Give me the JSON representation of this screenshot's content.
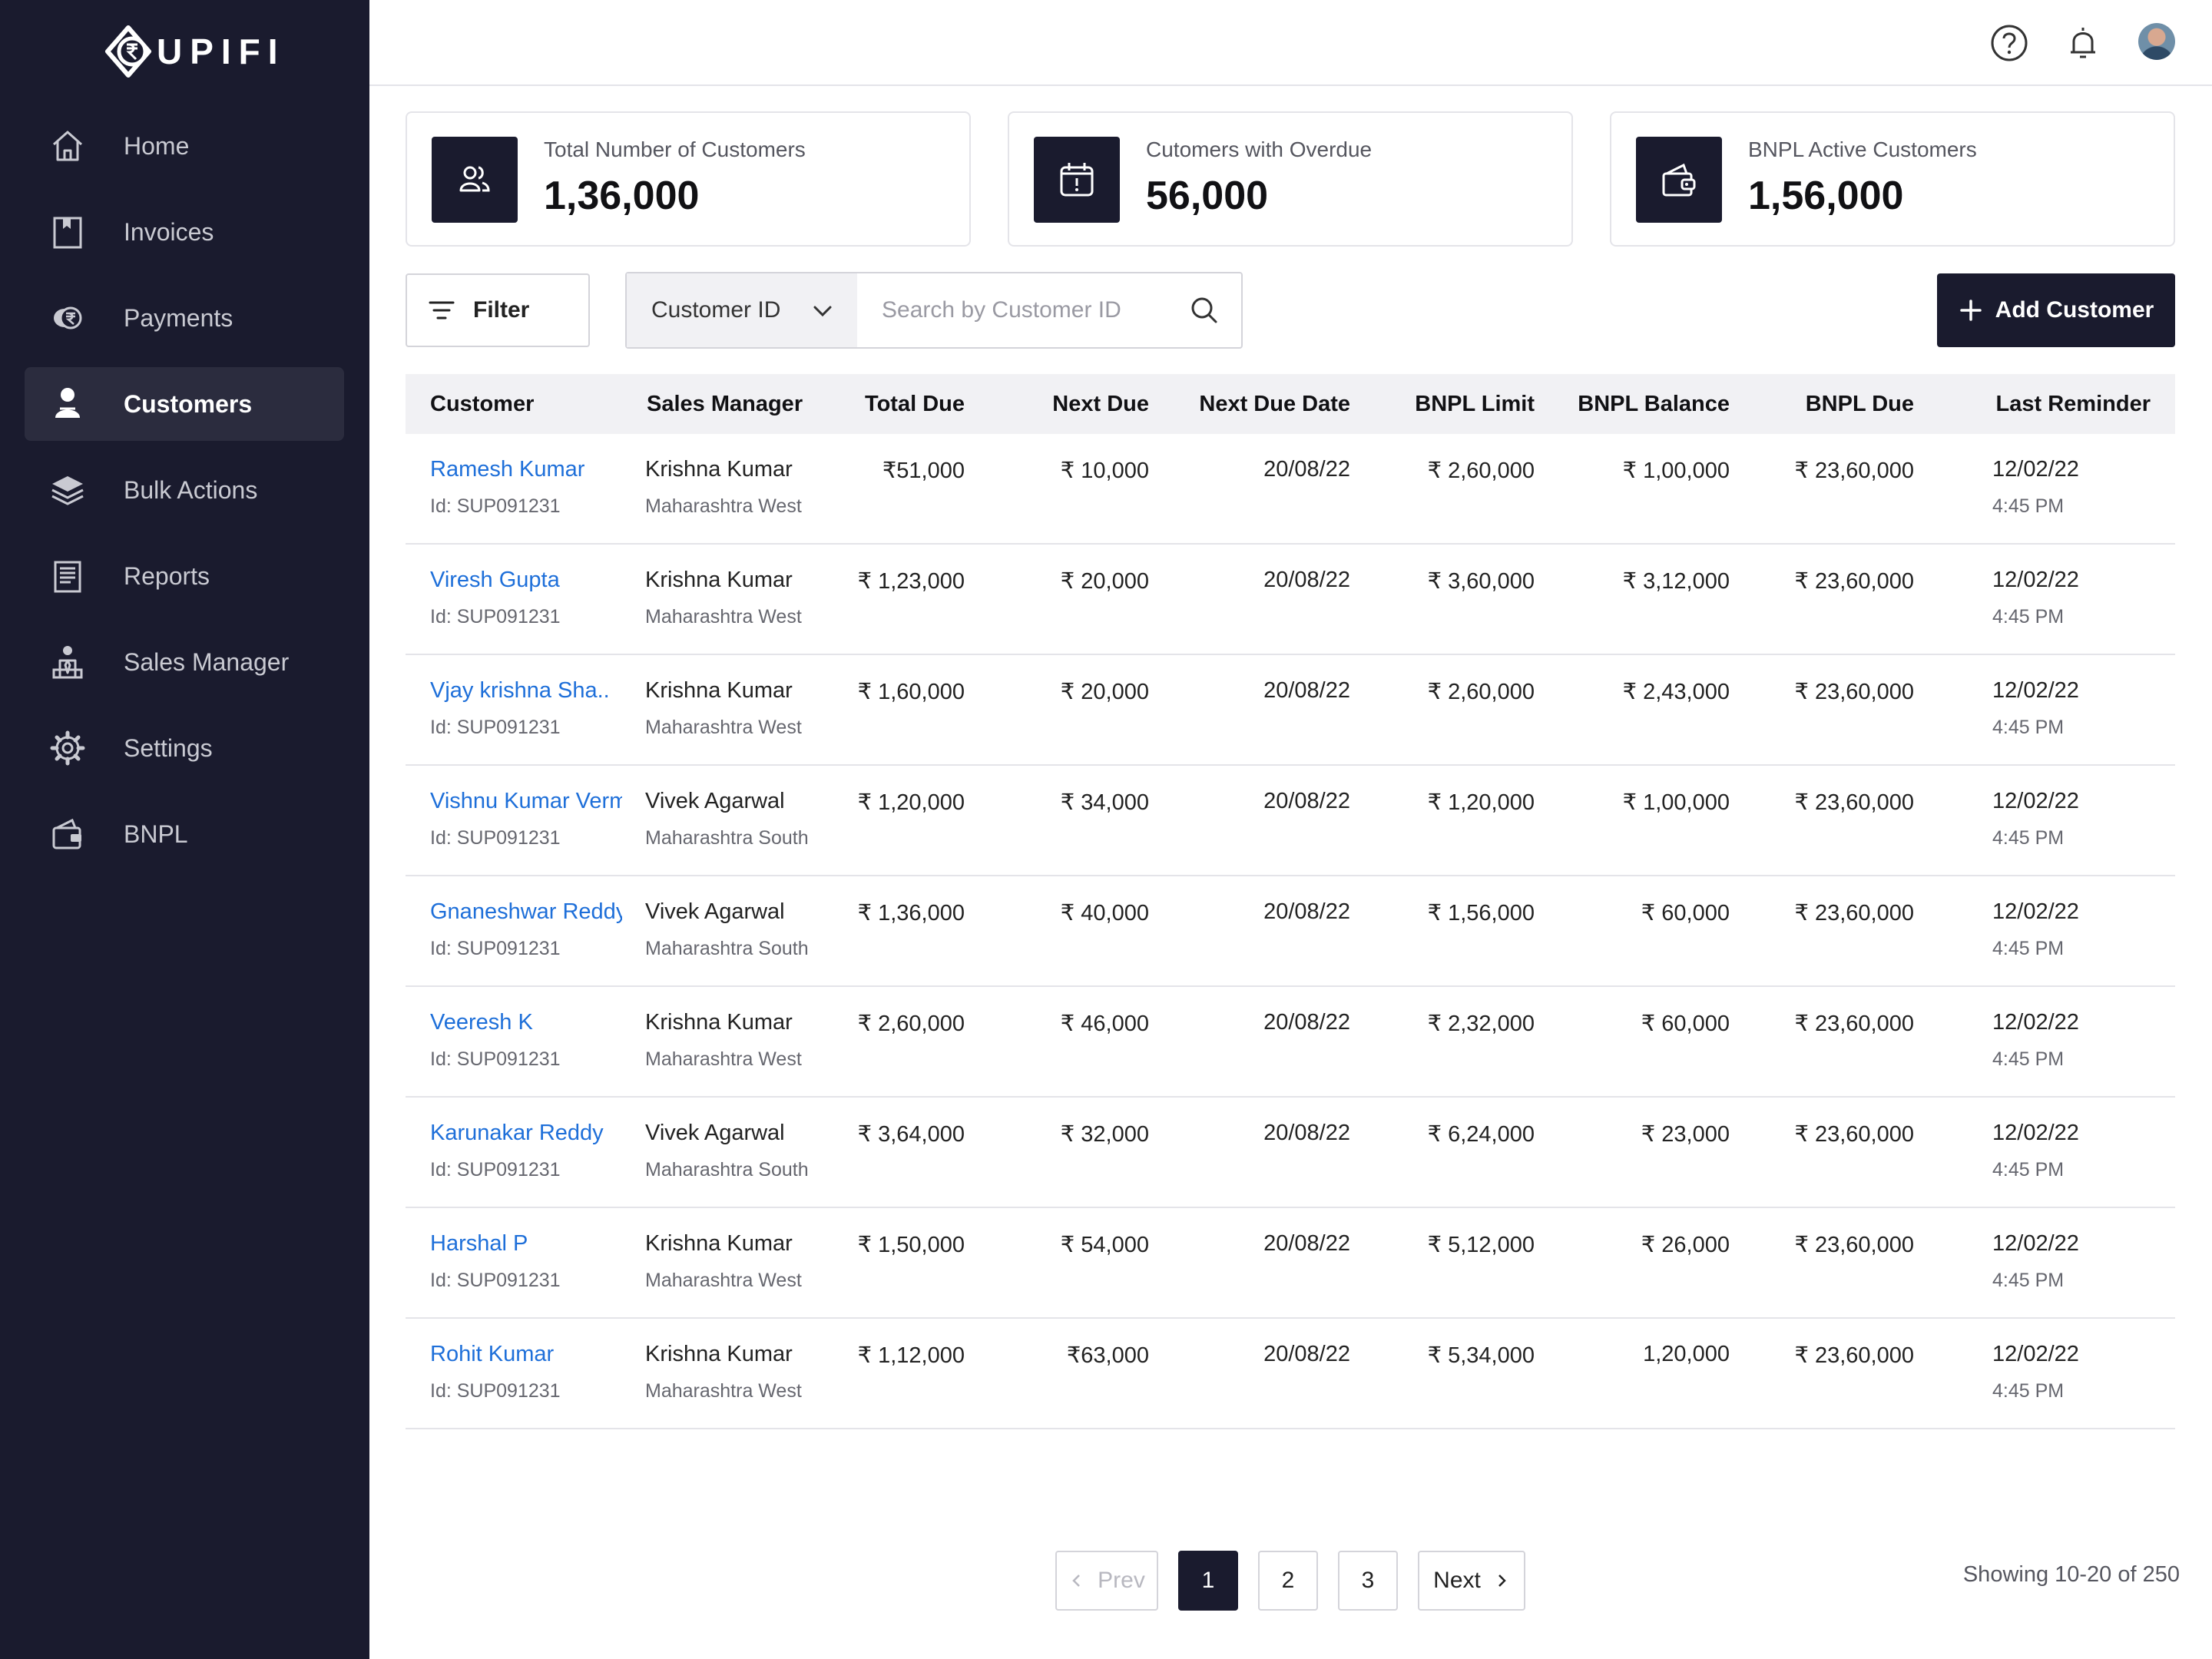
{
  "brand": {
    "name": "UPIFI"
  },
  "sidebar": {
    "items": [
      {
        "label": "Home",
        "icon": "home-icon",
        "active": false
      },
      {
        "label": "Invoices",
        "icon": "invoice-icon",
        "active": false
      },
      {
        "label": "Payments",
        "icon": "rupee-coin-icon",
        "active": false
      },
      {
        "label": "Customers",
        "icon": "user-icon",
        "active": true
      },
      {
        "label": "Bulk Actions",
        "icon": "layers-icon",
        "active": false
      },
      {
        "label": "Reports",
        "icon": "report-icon",
        "active": false
      },
      {
        "label": "Sales Manager",
        "icon": "sales-manager-icon",
        "active": false
      },
      {
        "label": "Settings",
        "icon": "gear-icon",
        "active": false
      },
      {
        "label": "BNPL",
        "icon": "wallet-icon",
        "active": false
      }
    ]
  },
  "header": {
    "icons": [
      "help-icon",
      "bell-icon",
      "avatar"
    ]
  },
  "cards": [
    {
      "label": "Total Number of Customers",
      "value": "1,36,000",
      "icon": "users-icon"
    },
    {
      "label": "Cutomers with Overdue",
      "value": "56,000",
      "icon": "calendar-alert-icon"
    },
    {
      "label": "BNPL Active Customers",
      "value": "1,56,000",
      "icon": "wallet-icon"
    }
  ],
  "toolbar": {
    "filter_label": "Filter",
    "search_field": "Customer ID",
    "search_placeholder": "Search by Customer ID",
    "add_label": "Add Customer"
  },
  "table": {
    "headers": {
      "customer": "Customer",
      "sales_manager": "Sales Manager",
      "total_due": "Total Due",
      "next_due": "Next Due",
      "next_due_date": "Next Due Date",
      "bnpl_limit": "BNPL Limit",
      "bnpl_balance": "BNPL Balance",
      "bnpl_due": "BNPL Due",
      "last_reminder": "Last Reminder"
    },
    "rows": [
      {
        "name": "Ramesh Kumar",
        "id": "Id: SUP091231",
        "manager": "Krishna Kumar",
        "region": "Maharashtra West",
        "total_due": "₹51,000",
        "next_due": "₹ 10,000",
        "next_due_date": "20/08/22",
        "bnpl_limit": "₹ 2,60,000",
        "bnpl_balance": "₹ 1,00,000",
        "bnpl_due": "₹ 23,60,000",
        "reminder_date": "12/02/22",
        "reminder_time": "4:45 PM"
      },
      {
        "name": "Viresh Gupta",
        "id": "Id: SUP091231",
        "manager": "Krishna Kumar",
        "region": "Maharashtra West",
        "total_due": "₹ 1,23,000",
        "next_due": "₹ 20,000",
        "next_due_date": "20/08/22",
        "bnpl_limit": "₹ 3,60,000",
        "bnpl_balance": "₹ 3,12,000",
        "bnpl_due": "₹ 23,60,000",
        "reminder_date": "12/02/22",
        "reminder_time": "4:45 PM"
      },
      {
        "name": "Vjay krishna Sha..",
        "id": "Id: SUP091231",
        "manager": "Krishna Kumar",
        "region": "Maharashtra West",
        "total_due": "₹ 1,60,000",
        "next_due": "₹ 20,000",
        "next_due_date": "20/08/22",
        "bnpl_limit": "₹ 2,60,000",
        "bnpl_balance": "₹ 2,43,000",
        "bnpl_due": "₹ 23,60,000",
        "reminder_date": "12/02/22",
        "reminder_time": "4:45 PM"
      },
      {
        "name": "Vishnu Kumar Verma",
        "id": "Id: SUP091231",
        "manager": "Vivek Agarwal",
        "region": "Maharashtra South",
        "total_due": "₹ 1,20,000",
        "next_due": "₹ 34,000",
        "next_due_date": "20/08/22",
        "bnpl_limit": "₹ 1,20,000",
        "bnpl_balance": "₹ 1,00,000",
        "bnpl_due": "₹ 23,60,000",
        "reminder_date": "12/02/22",
        "reminder_time": "4:45 PM"
      },
      {
        "name": "Gnaneshwar Reddy",
        "id": "Id: SUP091231",
        "manager": "Vivek Agarwal",
        "region": "Maharashtra South",
        "total_due": "₹ 1,36,000",
        "next_due": "₹ 40,000",
        "next_due_date": "20/08/22",
        "bnpl_limit": "₹ 1,56,000",
        "bnpl_balance": "₹ 60,000",
        "bnpl_due": "₹ 23,60,000",
        "reminder_date": "12/02/22",
        "reminder_time": "4:45 PM"
      },
      {
        "name": "Veeresh K",
        "id": "Id: SUP091231",
        "manager": "Krishna Kumar",
        "region": "Maharashtra West",
        "total_due": "₹ 2,60,000",
        "next_due": "₹ 46,000",
        "next_due_date": "20/08/22",
        "bnpl_limit": "₹ 2,32,000",
        "bnpl_balance": "₹ 60,000",
        "bnpl_due": "₹ 23,60,000",
        "reminder_date": "12/02/22",
        "reminder_time": "4:45 PM"
      },
      {
        "name": "Karunakar Reddy",
        "id": "Id: SUP091231",
        "manager": "Vivek Agarwal",
        "region": "Maharashtra South",
        "total_due": "₹ 3,64,000",
        "next_due": "₹ 32,000",
        "next_due_date": "20/08/22",
        "bnpl_limit": "₹ 6,24,000",
        "bnpl_balance": "₹ 23,000",
        "bnpl_due": "₹ 23,60,000",
        "reminder_date": "12/02/22",
        "reminder_time": "4:45 PM"
      },
      {
        "name": "Harshal P",
        "id": "Id: SUP091231",
        "manager": "Krishna Kumar",
        "region": "Maharashtra West",
        "total_due": "₹ 1,50,000",
        "next_due": "₹ 54,000",
        "next_due_date": "20/08/22",
        "bnpl_limit": "₹ 5,12,000",
        "bnpl_balance": "₹ 26,000",
        "bnpl_due": "₹ 23,60,000",
        "reminder_date": "12/02/22",
        "reminder_time": "4:45 PM"
      },
      {
        "name": "Rohit Kumar",
        "id": "Id: SUP091231",
        "manager": "Krishna Kumar",
        "region": "Maharashtra West",
        "total_due": "₹ 1,12,000",
        "next_due": "₹63,000",
        "next_due_date": "20/08/22",
        "bnpl_limit": "₹ 5,34,000",
        "bnpl_balance": "1,20,000",
        "bnpl_due": "₹ 23,60,000",
        "reminder_date": "12/02/22",
        "reminder_time": "4:45 PM"
      }
    ]
  },
  "pagination": {
    "prev_label": "Prev",
    "next_label": "Next",
    "pages": [
      "1",
      "2",
      "3"
    ],
    "current": "1",
    "showing": "Showing 10-20 of 250"
  }
}
